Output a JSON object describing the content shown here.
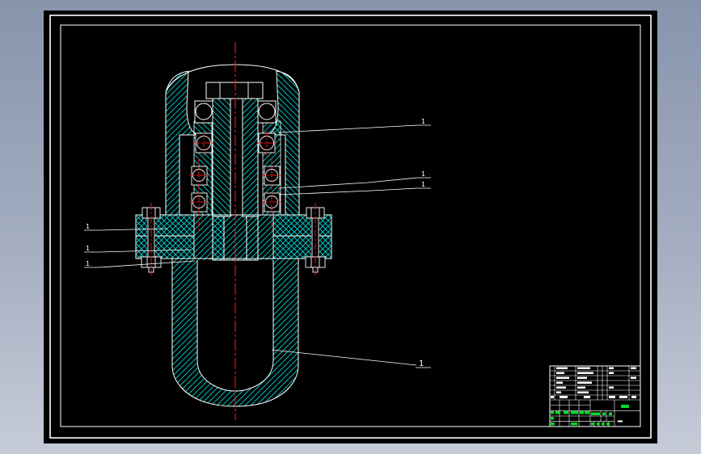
{
  "document": {
    "kind": "cad-drawing-sheet",
    "description": "Black CAD sheet with white double border frame on blue-gray desktop, mechanical section view of a spindle housing assembly"
  },
  "colors": {
    "background_top": "#8794ac",
    "background_bottom": "#c6cbd8",
    "sheet": "#000000",
    "line": "#ffffff",
    "hatch": "#00e6e6",
    "centerline": "#ee1111",
    "highlight_green": "#00dd22"
  },
  "drawing_labels": {
    "callouts": [
      "1",
      "1",
      "1",
      "1",
      "1",
      "1",
      "1"
    ]
  }
}
